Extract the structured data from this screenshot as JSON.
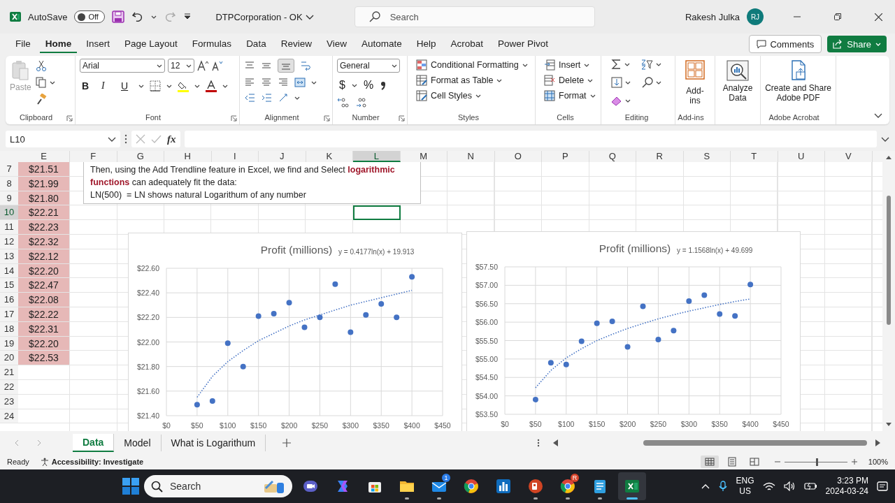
{
  "title_bar": {
    "autosave_label": "AutoSave",
    "autosave_on": false,
    "autosave_state": "Off",
    "document_title": "DTPCorporation - OK",
    "search_placeholder": "Search",
    "user_name": "Rakesh Julka",
    "avatar_initials": "RJ"
  },
  "ribbon_tabs": [
    {
      "label": "File",
      "selected": false
    },
    {
      "label": "Home",
      "selected": true
    },
    {
      "label": "Insert",
      "selected": false
    },
    {
      "label": "Page Layout",
      "selected": false
    },
    {
      "label": "Formulas",
      "selected": false
    },
    {
      "label": "Data",
      "selected": false
    },
    {
      "label": "Review",
      "selected": false
    },
    {
      "label": "View",
      "selected": false
    },
    {
      "label": "Automate",
      "selected": false
    },
    {
      "label": "Help",
      "selected": false
    },
    {
      "label": "Acrobat",
      "selected": false
    },
    {
      "label": "Power Pivot",
      "selected": false
    }
  ],
  "comments_button": "Comments",
  "share_button": "Share",
  "ribbon": {
    "clipboard": {
      "paste": "Paste",
      "label": "Clipboard"
    },
    "font": {
      "font_name": "Arial",
      "font_size": "12",
      "bold": "B",
      "italic": "I",
      "underline": "U",
      "label": "Font"
    },
    "alignment": {
      "label": "Alignment"
    },
    "number": {
      "format": "General",
      "currency": "$",
      "percent": "%",
      "label": "Number"
    },
    "styles": {
      "items": [
        "Conditional Formatting",
        "Format as Table",
        "Cell Styles"
      ],
      "label": "Styles"
    },
    "cells": {
      "items": [
        "Insert",
        "Delete",
        "Format"
      ],
      "label": "Cells"
    },
    "editing": {
      "label": "Editing"
    },
    "addins": {
      "button": "Add-ins",
      "label": "Add-ins"
    },
    "analyze": {
      "button": "Analyze Data"
    },
    "acrobat": {
      "button": "Create and Share Adobe PDF",
      "label": "Adobe Acrobat"
    }
  },
  "formula_bar": {
    "name_box": "L10",
    "fx": "fx"
  },
  "columns": [
    {
      "label": "E",
      "selected": false
    },
    {
      "label": "F",
      "selected": false
    },
    {
      "label": "G",
      "selected": false
    },
    {
      "label": "H",
      "selected": false
    },
    {
      "label": "I",
      "selected": false
    },
    {
      "label": "J",
      "selected": false
    },
    {
      "label": "K",
      "selected": false
    },
    {
      "label": "L",
      "selected": true
    },
    {
      "label": "M",
      "selected": false
    },
    {
      "label": "N",
      "selected": false
    },
    {
      "label": "O",
      "selected": false
    },
    {
      "label": "P",
      "selected": false
    },
    {
      "label": "Q",
      "selected": false
    },
    {
      "label": "R",
      "selected": false
    },
    {
      "label": "S",
      "selected": false
    },
    {
      "label": "T",
      "selected": false
    },
    {
      "label": "U",
      "selected": false
    },
    {
      "label": "V",
      "selected": false
    }
  ],
  "rows": [
    {
      "label": "7",
      "selected": false,
      "column_e": "$21.51"
    },
    {
      "label": "8",
      "selected": false,
      "column_e": "$21.99"
    },
    {
      "label": "9",
      "selected": false,
      "column_e": "$21.80"
    },
    {
      "label": "10",
      "selected": true,
      "column_e": "$22.21"
    },
    {
      "label": "11",
      "selected": false,
      "column_e": "$22.23"
    },
    {
      "label": "12",
      "selected": false,
      "column_e": "$22.32"
    },
    {
      "label": "13",
      "selected": false,
      "column_e": "$22.12"
    },
    {
      "label": "14",
      "selected": false,
      "column_e": "$22.20"
    },
    {
      "label": "15",
      "selected": false,
      "column_e": "$22.47"
    },
    {
      "label": "16",
      "selected": false,
      "column_e": "$22.08"
    },
    {
      "label": "17",
      "selected": false,
      "column_e": "$22.22"
    },
    {
      "label": "18",
      "selected": false,
      "column_e": "$22.31"
    },
    {
      "label": "19",
      "selected": false,
      "column_e": "$22.20"
    },
    {
      "label": "20",
      "selected": false,
      "column_e": "$22.53"
    },
    {
      "label": "21",
      "selected": false
    },
    {
      "label": "22",
      "selected": false
    },
    {
      "label": "23",
      "selected": false
    },
    {
      "label": "24",
      "selected": false
    }
  ],
  "text_box": {
    "lines": [
      "Then, using the Add Trendline feature in Excel, we find and Select **logarithmic functions** can adequately fit the data:",
      "LN(500)  = LN shows natural Logarithum of any number"
    ]
  },
  "charts": [
    {
      "chart_data": {
        "type": "scatter",
        "title": "Profit (millions)",
        "grid": true,
        "x": [
          50,
          75,
          100,
          125,
          150,
          175,
          200,
          225,
          250,
          275,
          300,
          325,
          350,
          375,
          400
        ],
        "series": [
          {
            "color": "#4472c4",
            "values": [
              21.49,
              21.52,
              21.99,
              21.8,
              22.21,
              22.23,
              22.32,
              22.12,
              22.2,
              22.47,
              22.08,
              22.22,
              22.31,
              22.2,
              22.53
            ]
          },
          {
            "type": "line",
            "line_style": "dotted",
            "color": "#4472c4",
            "values": [
              21.55,
              21.72,
              21.84,
              21.93,
              22.01,
              22.07,
              22.13,
              22.18,
              22.22,
              22.26,
              22.3,
              22.33,
              22.36,
              22.39,
              22.42
            ]
          }
        ],
        "xlim": [
          0,
          450
        ],
        "ylim": [
          21.4,
          22.6
        ],
        "xticks": [
          {
            "value": 0,
            "label": "$0"
          },
          {
            "value": 50,
            "label": "$50"
          },
          {
            "value": 100,
            "label": "$100"
          },
          {
            "value": 150,
            "label": "$150"
          },
          {
            "value": 200,
            "label": "$200"
          },
          {
            "value": 250,
            "label": "$250"
          },
          {
            "value": 300,
            "label": "$300"
          },
          {
            "value": 350,
            "label": "$350"
          },
          {
            "value": 400,
            "label": "$400"
          },
          {
            "value": 450,
            "label": "$450"
          }
        ],
        "yticks": [
          {
            "value": 21.4,
            "label": "$21.40"
          },
          {
            "value": 21.6,
            "label": "$21.60"
          },
          {
            "value": 21.8,
            "label": "$21.80"
          },
          {
            "value": 22.0,
            "label": "$22.00"
          },
          {
            "value": 22.2,
            "label": "$22.20"
          },
          {
            "value": 22.4,
            "label": "$22.40"
          },
          {
            "value": 22.6,
            "label": "$22.60"
          }
        ],
        "annotations": [
          {
            "text": "y = 0.4177ln(x) + 19.913"
          }
        ]
      }
    },
    {
      "chart_data": {
        "type": "scatter",
        "title": "Profit (millions)",
        "grid": true,
        "x": [
          50,
          75,
          100,
          125,
          150,
          175,
          200,
          225,
          250,
          275,
          300,
          325,
          350,
          375,
          400
        ],
        "series": [
          {
            "color": "#4472c4",
            "values": [
              53.9,
              54.9,
              54.85,
              55.48,
              55.97,
              56.02,
              55.33,
              56.43,
              55.53,
              55.77,
              56.57,
              56.73,
              56.22,
              56.17,
              57.02
            ]
          },
          {
            "type": "line",
            "line_style": "dotted",
            "color": "#4472c4",
            "values": [
              54.22,
              54.69,
              55.03,
              55.28,
              55.5,
              55.67,
              55.83,
              55.96,
              56.09,
              56.2,
              56.3,
              56.39,
              56.48,
              56.56,
              56.63
            ]
          }
        ],
        "xlim": [
          0,
          450
        ],
        "ylim": [
          53.5,
          57.5
        ],
        "xticks": [
          {
            "value": 0,
            "label": "$0"
          },
          {
            "value": 50,
            "label": "$50"
          },
          {
            "value": 100,
            "label": "$100"
          },
          {
            "value": 150,
            "label": "$150"
          },
          {
            "value": 200,
            "label": "$200"
          },
          {
            "value": 250,
            "label": "$250"
          },
          {
            "value": 300,
            "label": "$300"
          },
          {
            "value": 350,
            "label": "$350"
          },
          {
            "value": 400,
            "label": "$400"
          },
          {
            "value": 450,
            "label": "$450"
          }
        ],
        "yticks": [
          {
            "value": 53.5,
            "label": "$53.50"
          },
          {
            "value": 54.0,
            "label": "$54.00"
          },
          {
            "value": 54.5,
            "label": "$54.50"
          },
          {
            "value": 55.0,
            "label": "$55.00"
          },
          {
            "value": 55.5,
            "label": "$55.50"
          },
          {
            "value": 56.0,
            "label": "$56.00"
          },
          {
            "value": 56.5,
            "label": "$56.50"
          },
          {
            "value": 57.0,
            "label": "$57.00"
          },
          {
            "value": 57.5,
            "label": "$57.50"
          }
        ],
        "annotations": [
          {
            "text": "y = 1.1568ln(x) + 49.699"
          }
        ]
      }
    }
  ],
  "sheet_tabs": [
    {
      "label": "Data",
      "selected": true
    },
    {
      "label": "Model",
      "selected": false
    },
    {
      "label": "What is Logarithum",
      "selected": false
    }
  ],
  "status_bar": {
    "ready": "Ready",
    "accessibility": "Accessibility: Investigate",
    "views": [
      {
        "kind": "normal",
        "selected": true
      },
      {
        "kind": "page_layout",
        "selected": false
      },
      {
        "kind": "page_break",
        "selected": false
      }
    ],
    "zoom_slider": {
      "level": 0.5
    },
    "zoom": "100%"
  },
  "taskbar": {
    "search_placeholder": "Search",
    "apps": [
      {
        "kind": "meet",
        "running": false,
        "selected": false
      },
      {
        "kind": "copilot",
        "running": false,
        "selected": false
      },
      {
        "kind": "store",
        "running": false,
        "selected": false
      },
      {
        "kind": "folder",
        "running": true,
        "selected": false
      },
      {
        "kind": "mail",
        "running": true,
        "selected": false,
        "badge": "1"
      },
      {
        "kind": "browser",
        "running": false,
        "selected": false
      },
      {
        "kind": "charts",
        "running": false,
        "selected": false
      },
      {
        "kind": "slides",
        "running": true,
        "selected": false
      },
      {
        "kind": "browser",
        "running": true,
        "selected": false,
        "badge": "R"
      },
      {
        "kind": "notepad",
        "running": true,
        "selected": false
      },
      {
        "kind": "sheets",
        "running": true,
        "selected": true
      }
    ],
    "language": "ENG",
    "region": "US",
    "time": "3:23 PM",
    "date": "2024-03-24"
  }
}
